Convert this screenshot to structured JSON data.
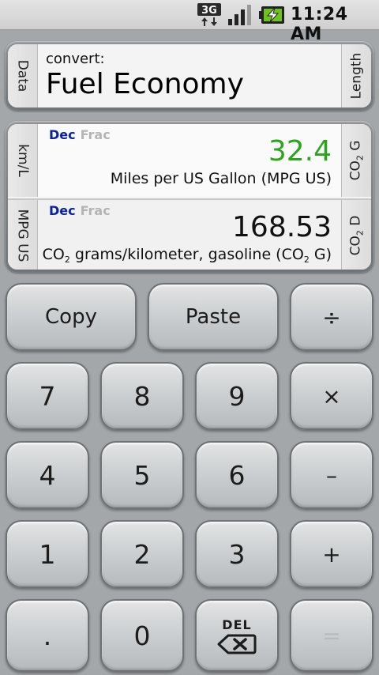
{
  "status_bar": {
    "network": "3G",
    "time": "11:24 AM"
  },
  "header": {
    "left_tab": "Data",
    "right_tab": "Length",
    "prefix": "convert:",
    "title": "Fuel Economy"
  },
  "rows": [
    {
      "left_tab": "km/L",
      "right_tab": "CO",
      "right_tab_sub": "2",
      "right_tab_suffix": " G",
      "format_dec": "Dec",
      "format_frac": "Frac",
      "value": "32.4",
      "unit": "Miles per US Gallon (MPG US)"
    },
    {
      "left_tab": "MPG US",
      "right_tab": "CO",
      "right_tab_sub": "2",
      "right_tab_suffix": " D",
      "format_dec": "Dec",
      "format_frac": "Frac",
      "value": "168.53",
      "unit_pre": "CO",
      "unit_sub": "2",
      "unit_mid": " grams/kilometer, gasoline (CO",
      "unit_sub2": "2",
      "unit_end": " G)"
    }
  ],
  "keys": {
    "copy": "Copy",
    "paste": "Paste",
    "divide": "÷",
    "seven": "7",
    "eight": "8",
    "nine": "9",
    "multiply": "×",
    "four": "4",
    "five": "5",
    "six": "6",
    "minus": "–",
    "one": "1",
    "two": "2",
    "three": "3",
    "plus": "+",
    "dot": ".",
    "zero": "0",
    "del": "DEL",
    "equals": "="
  }
}
